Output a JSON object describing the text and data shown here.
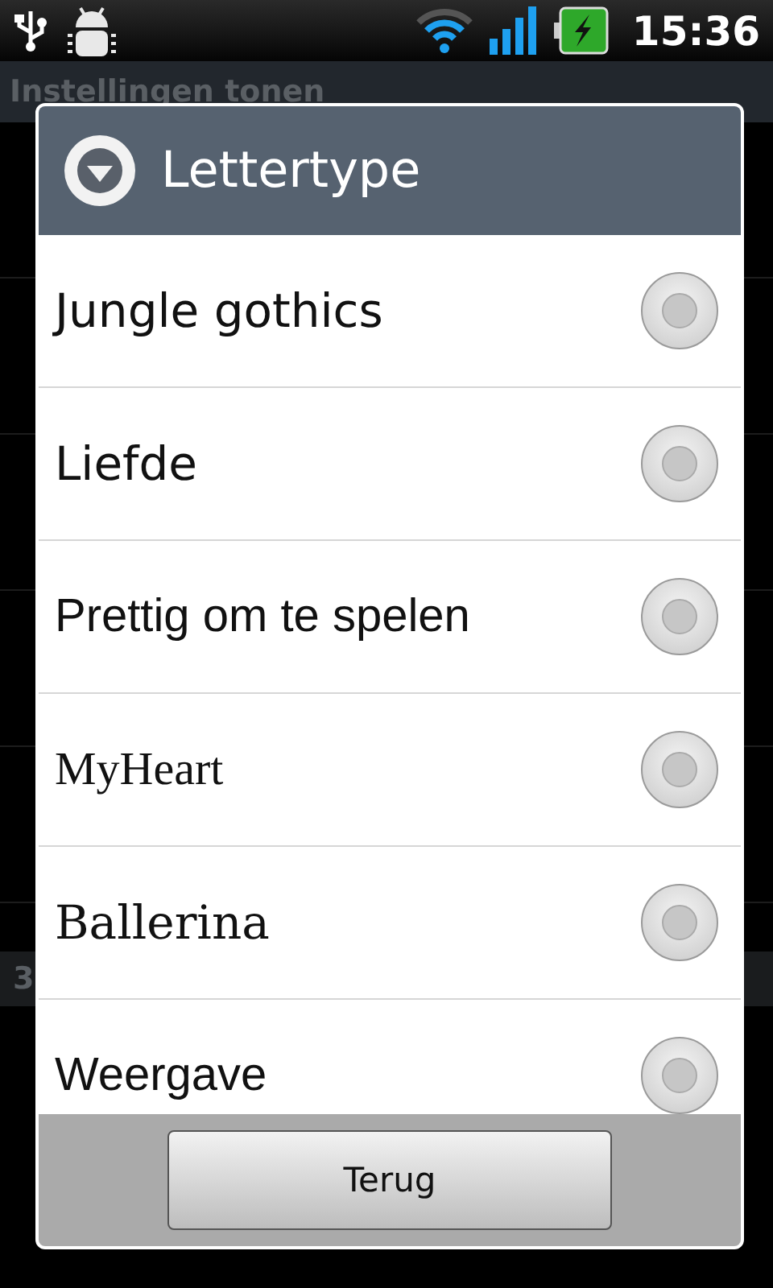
{
  "status_bar": {
    "time": "15:36"
  },
  "background": {
    "title": "Instellingen tonen",
    "section_label": "3"
  },
  "dialog": {
    "title": "Lettertype",
    "options": [
      {
        "label": "Jungle gothics",
        "selected": false
      },
      {
        "label": "Liefde",
        "selected": false
      },
      {
        "label": "Prettig om te spelen",
        "selected": false
      },
      {
        "label": "MyHeart",
        "selected": false
      },
      {
        "label": "Ballerina",
        "selected": false
      },
      {
        "label": "Weergave",
        "selected": false
      }
    ],
    "button": "Terug"
  }
}
